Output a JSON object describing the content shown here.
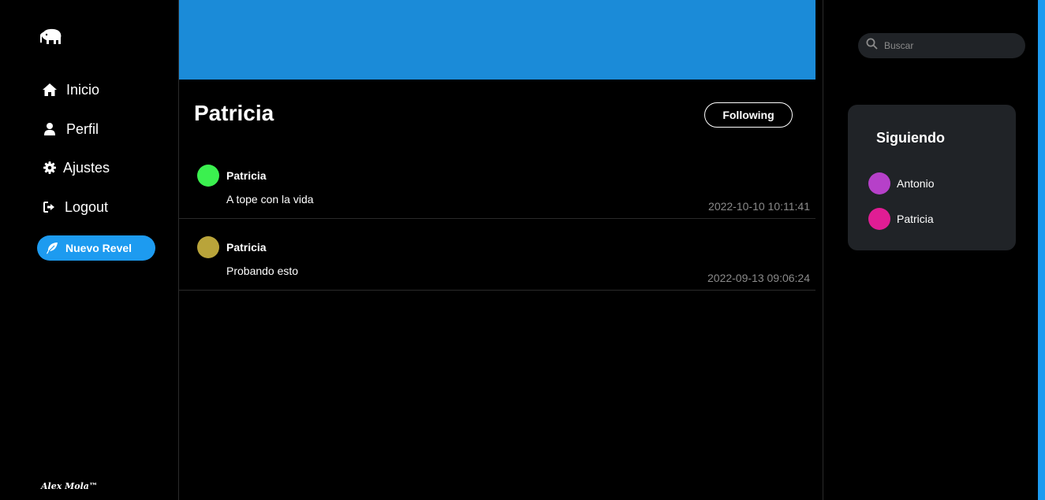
{
  "sidebar": {
    "logo_icon": "elephant-logo-icon",
    "nav": [
      {
        "label": "Inicio",
        "icon": "home-icon"
      },
      {
        "label": "Perfil",
        "icon": "user-icon"
      },
      {
        "label": "Ajustes",
        "icon": "gear-icon"
      },
      {
        "label": "Logout",
        "icon": "logout-icon"
      }
    ],
    "new_button": {
      "label": "Nuevo Revel",
      "icon": "feather-icon"
    },
    "footer": "Alex Mola™"
  },
  "profile": {
    "banner_color": "#1b8bd8",
    "name": "Patricia",
    "follow_button": "Following"
  },
  "posts": [
    {
      "author": "Patricia",
      "text": "A tope con la vida",
      "time": "2022-10-10 10:11:41",
      "avatar_color": "#3bf04f"
    },
    {
      "author": "Patricia",
      "text": "Probando esto",
      "time": "2022-09-13 09:06:24",
      "avatar_color": "#b9a43a"
    }
  ],
  "search": {
    "placeholder": "Buscar",
    "value": "",
    "icon": "search-icon"
  },
  "following": {
    "title": "Siguiendo",
    "users": [
      {
        "name": "Antonio",
        "color": "#b640c9"
      },
      {
        "name": "Patricia",
        "color": "#e01d94"
      }
    ]
  },
  "colors": {
    "accent": "#1d9bf0",
    "background": "#000000",
    "card": "#202327"
  }
}
